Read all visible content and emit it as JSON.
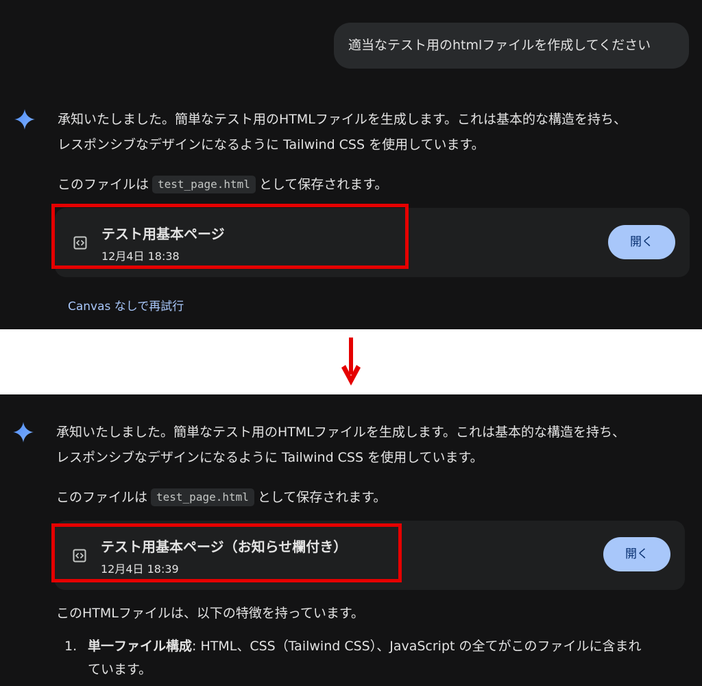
{
  "top_panel": {
    "user_message": "適当なテスト用のhtmlファイルを作成してください",
    "response": {
      "line1": "承知いたしました。簡単なテスト用のHTMLファイルを生成します。これは基本的な構造を持ち、",
      "line2": "レスポンシブなデザインになるように Tailwind CSS を使用しています。",
      "save_prefix": "このファイルは",
      "filename": "test_page.html",
      "save_suffix": "として保存されます。"
    },
    "card": {
      "title": "テスト用基本ページ",
      "date": "12月4日 18:38",
      "open_label": "開く"
    },
    "retry_link": "Canvas なしで再試行"
  },
  "bottom_panel": {
    "response": {
      "line1": "承知いたしました。簡単なテスト用のHTMLファイルを生成します。これは基本的な構造を持ち、",
      "line2": "レスポンシブなデザインになるように Tailwind CSS を使用しています。",
      "save_prefix": "このファイルは",
      "filename": "test_page.html",
      "save_suffix": "として保存されます。"
    },
    "card": {
      "title": "テスト用基本ページ（お知らせ欄付き）",
      "date": "12月4日 18:39",
      "open_label": "開く"
    },
    "features_intro": "このHTMLファイルは、以下の特徴を持っています。",
    "features": [
      {
        "number": "1.",
        "title": "単一ファイル構成",
        "text_line1": ": HTML、CSS（Tailwind CSS）、JavaScript の全てがこのファイルに含まれ",
        "text_line2": "ています。"
      }
    ]
  },
  "icons": {
    "assistant": "gemini-sparkle-icon",
    "card": "code-file-icon",
    "transition": "down-arrow-icon"
  },
  "colors": {
    "background": "#131314",
    "bubble": "#282a2c",
    "card": "#1e1f20",
    "button": "#a8c7fa",
    "link": "#a8c7fa",
    "highlight": "#e50000"
  }
}
